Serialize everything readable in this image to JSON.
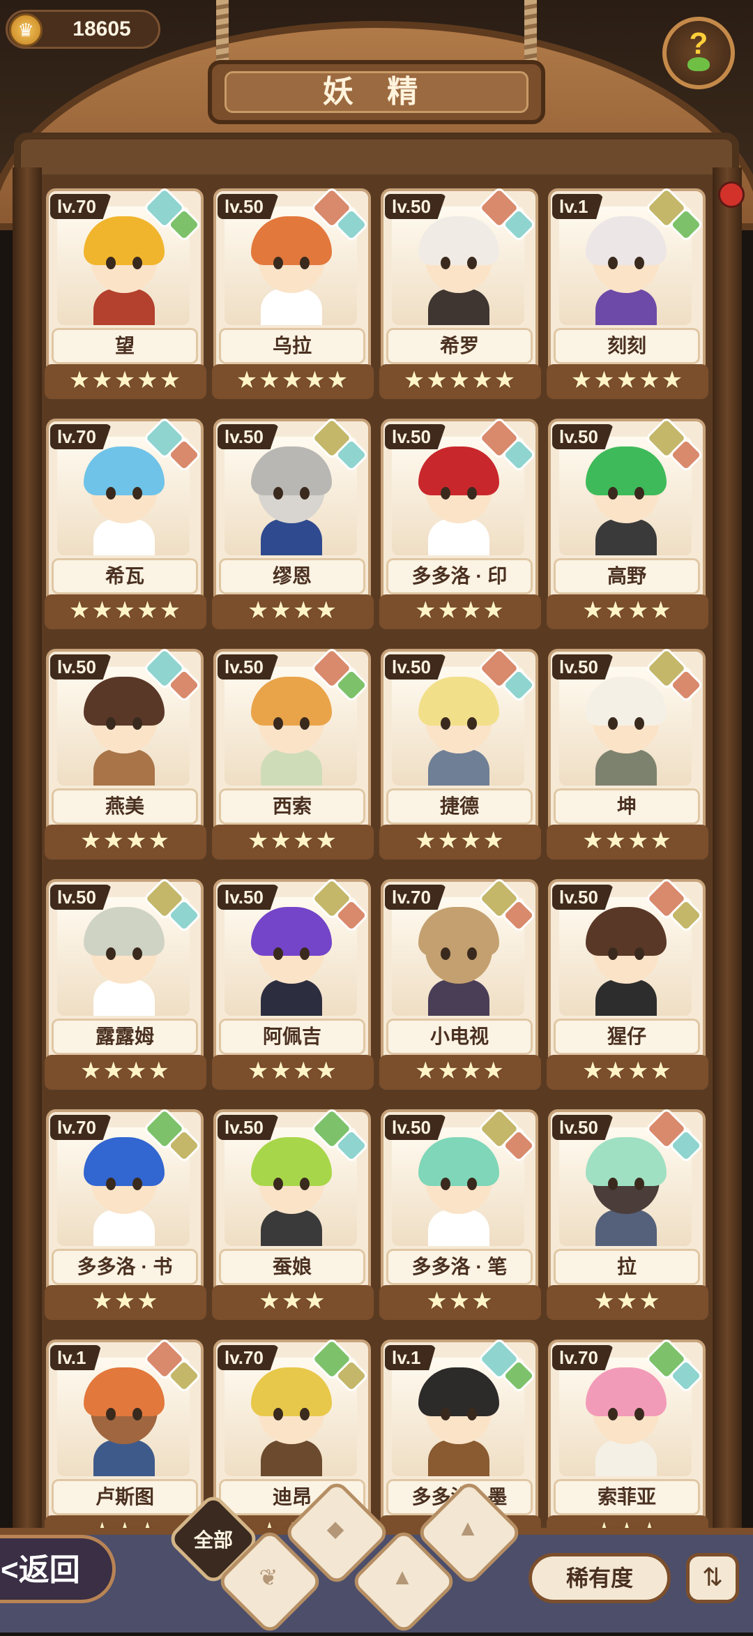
{
  "header": {
    "currency_value": "18605",
    "title": "妖 精",
    "help_symbol": "?"
  },
  "fairies": [
    {
      "level": "lv.70",
      "name": "望",
      "stars": "★★★★★",
      "gems": [
        "#8fd4cf",
        "#7dc26b"
      ],
      "hair": "#f0b52c",
      "skin": "#fbe3c8",
      "body": "#b3412d"
    },
    {
      "level": "lv.50",
      "name": "乌拉",
      "stars": "★★★★★",
      "gems": [
        "#d98a6c",
        "#8fd4cf"
      ],
      "hair": "#e2783c",
      "skin": "#fbe3c8",
      "body": "#ffffff"
    },
    {
      "level": "lv.50",
      "name": "希罗",
      "stars": "★★★★★",
      "gems": [
        "#d98a6c",
        "#8fd4cf"
      ],
      "hair": "#f0ebe4",
      "skin": "#fbe3c8",
      "body": "#3f3631"
    },
    {
      "level": "lv.1",
      "name": "刻刻",
      "stars": "★★★★★",
      "gems": [
        "#c4b76a",
        "#7dc26b"
      ],
      "hair": "#ece6e6",
      "skin": "#fbe3c8",
      "body": "#6d4aa8"
    },
    {
      "level": "lv.70",
      "name": "希瓦",
      "stars": "★★★★★",
      "gems": [
        "#8fd4cf",
        "#d98a6c"
      ],
      "hair": "#6fc3e8",
      "skin": "#fbe3c8",
      "body": "#ffffff"
    },
    {
      "level": "lv.50",
      "name": "缪恩",
      "stars": "★★★★",
      "gems": [
        "#c4b76a",
        "#8fd4cf"
      ],
      "hair": "#b9b7b3",
      "skin": "#d8d5d0",
      "body": "#2f4a8e"
    },
    {
      "level": "lv.50",
      "name": "多多洛 · 印",
      "stars": "★★★★",
      "gems": [
        "#d98a6c",
        "#8fd4cf"
      ],
      "hair": "#c8282c",
      "skin": "#fbe3c8",
      "body": "#ffffff"
    },
    {
      "level": "lv.50",
      "name": "高野",
      "stars": "★★★★",
      "gems": [
        "#c4b76a",
        "#d98a6c"
      ],
      "hair": "#3fba5a",
      "skin": "#fbe3c8",
      "body": "#3a3a3a"
    },
    {
      "level": "lv.50",
      "name": "燕美",
      "stars": "★★★★",
      "gems": [
        "#8fd4cf",
        "#d98a6c"
      ],
      "hair": "#5a3828",
      "skin": "#fbe3c8",
      "body": "#a87448"
    },
    {
      "level": "lv.50",
      "name": "西索",
      "stars": "★★★★",
      "gems": [
        "#d98a6c",
        "#7dc26b"
      ],
      "hair": "#e9a44a",
      "skin": "#fbe3c8",
      "body": "#cfdcb8"
    },
    {
      "level": "lv.50",
      "name": "捷德",
      "stars": "★★★★",
      "gems": [
        "#d98a6c",
        "#8fd4cf"
      ],
      "hair": "#f2df8a",
      "skin": "#fbe3c8",
      "body": "#6f7f95"
    },
    {
      "level": "lv.50",
      "name": "坤",
      "stars": "★★★★",
      "gems": [
        "#c4b76a",
        "#d98a6c"
      ],
      "hair": "#f4f0e6",
      "skin": "#fbe3c8",
      "body": "#7d826e"
    },
    {
      "level": "lv.50",
      "name": "露露姆",
      "stars": "★★★★",
      "gems": [
        "#c4b76a",
        "#8fd4cf"
      ],
      "hair": "#cfd3c4",
      "skin": "#fbe3c8",
      "body": "#ffffff"
    },
    {
      "level": "lv.50",
      "name": "阿佩吉",
      "stars": "★★★★",
      "gems": [
        "#c4b76a",
        "#d98a6c"
      ],
      "hair": "#7445c8",
      "skin": "#fbe3c8",
      "body": "#2d2d40"
    },
    {
      "level": "lv.70",
      "name": "小电视",
      "stars": "★★★★",
      "gems": [
        "#c4b76a",
        "#d98a6c"
      ],
      "hair": "#c4a070",
      "skin": "#c4a070",
      "body": "#4a3d56"
    },
    {
      "level": "lv.50",
      "name": "猩仔",
      "stars": "★★★★",
      "gems": [
        "#d98a6c",
        "#c4b76a"
      ],
      "hair": "#5a3828",
      "skin": "#fbe3c8",
      "body": "#2d2d2d"
    },
    {
      "level": "lv.70",
      "name": "多多洛 · 书",
      "stars": "★★★",
      "gems": [
        "#7dc26b",
        "#c4b76a"
      ],
      "hair": "#3266d0",
      "skin": "#fbe3c8",
      "body": "#ffffff"
    },
    {
      "level": "lv.50",
      "name": "蚕娘",
      "stars": "★★★",
      "gems": [
        "#7dc26b",
        "#8fd4cf"
      ],
      "hair": "#a8d64a",
      "skin": "#fbe3c8",
      "body": "#3a3a3a"
    },
    {
      "level": "lv.50",
      "name": "多多洛 · 笔",
      "stars": "★★★",
      "gems": [
        "#c4b76a",
        "#d98a6c"
      ],
      "hair": "#7fd6b8",
      "skin": "#fbe3c8",
      "body": "#ffffff"
    },
    {
      "level": "lv.50",
      "name": "拉",
      "stars": "★★★",
      "gems": [
        "#d98a6c",
        "#8fd4cf"
      ],
      "hair": "#9fe0c2",
      "skin": "#4a3d3a",
      "body": "#55607a"
    },
    {
      "level": "lv.1",
      "name": "卢斯图",
      "stars": "★★★",
      "gems": [
        "#d98a6c",
        "#c4b76a"
      ],
      "hair": "#e2783c",
      "skin": "#a06640",
      "body": "#3e5a8a"
    },
    {
      "level": "lv.70",
      "name": "迪昂",
      "stars": "★★★",
      "gems": [
        "#7dc26b",
        "#c4b76a"
      ],
      "hair": "#e8c84a",
      "skin": "#fbe3c8",
      "body": "#6b4a2e"
    },
    {
      "level": "lv.1",
      "name": "多多洛 · 墨",
      "stars": "★★★",
      "gems": [
        "#8fd4cf",
        "#7dc26b"
      ],
      "hair": "#2d2a2a",
      "skin": "#fbe3c8",
      "body": "#8a5a30"
    },
    {
      "level": "lv.70",
      "name": "索菲亚",
      "stars": "★★★",
      "gems": [
        "#7dc26b",
        "#8fd4cf"
      ],
      "hair": "#f29bb8",
      "skin": "#fbe3c8",
      "body": "#f4f0e6"
    }
  ],
  "bottom": {
    "back_label": "返回",
    "back_chevron": "<",
    "tab_all_label": "全部",
    "rarity_label": "稀有度",
    "sort_icon": "sort-icon"
  },
  "colors": {
    "gem_water": "#8fd4cf",
    "gem_plant": "#7dc26b",
    "gem_earth": "#c4b76a",
    "gem_fire": "#d98a6c",
    "wood": "#7b4e2c"
  }
}
